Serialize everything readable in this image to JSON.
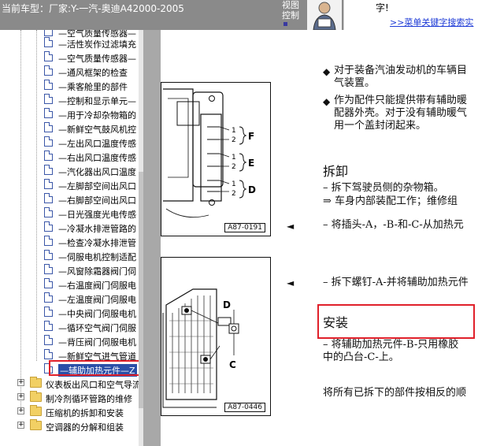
{
  "header": {
    "title": "当前车型：厂家:Y-一汽-奥迪A42000-2005",
    "view_control": [
      "视图",
      "控制"
    ],
    "ad_line1": "字!",
    "ad_link": ">>菜单关键字搜索实"
  },
  "tree": {
    "items": [
      {
        "label": "—空气质量传感器—",
        "cut": true
      },
      {
        "label": "—活性炭作过滤填充"
      },
      {
        "label": "—空气质量传感器—"
      },
      {
        "label": "—通风框架的检查"
      },
      {
        "label": "—乘客舱里的部件"
      },
      {
        "label": "—控制和显示单元—"
      },
      {
        "label": "—用于冷却杂物箱的"
      },
      {
        "label": "—新鲜空气鼓风机控"
      },
      {
        "label": "—左出风口温度传感"
      },
      {
        "label": "—右出风口温度传感"
      },
      {
        "label": "—汽化器出风口温度"
      },
      {
        "label": "—左脚部空间出风口"
      },
      {
        "label": "—右脚部空间出风口"
      },
      {
        "label": "—日光强度光电传感"
      },
      {
        "label": "—冷凝水排泄管路的"
      },
      {
        "label": "—检查冷凝水排泄管"
      },
      {
        "label": "—伺服电机控制适配"
      },
      {
        "label": "—风窗除霜器阀门伺"
      },
      {
        "label": "—右温度阀门伺服电"
      },
      {
        "label": "—左温度阀门伺服电"
      },
      {
        "label": "—中央阀门伺服电机"
      },
      {
        "label": "—循环空气阀门伺服"
      },
      {
        "label": "—背压阀门伺服电机"
      },
      {
        "label": "—新鲜空气进气管道"
      },
      {
        "label": "—辅助加热元件—Z",
        "selected": true
      }
    ],
    "folders": [
      "仪表板出风口和空气导流",
      "制冷剂循环管路的维修",
      "压缩机的拆卸和安装",
      "空调器的分解和组装"
    ]
  },
  "document": {
    "bullets": [
      "对于装备汽油发动机的车辆目",
      "气装置。",
      "作为配件只能提供带有辅助暖",
      "配器外壳。对于没有辅助暖气",
      "用一个盖封闭起来。"
    ],
    "removal_heading": "拆卸",
    "removal_steps": [
      "– 拆下驾驶员侧的杂物箱。",
      "⇒ 车身内部装配工作；维修组",
      "– 将插头-A，-B-和-C-从加热元",
      "– 拆下螺钉-A-并将辅助加热元件"
    ],
    "install_heading": "安装",
    "install_steps": [
      "– 将辅助加热元件-B-只用橡胶",
      "中的凸台-C-上。"
    ],
    "final_text": "将所有已拆下的部件按相反的顺",
    "figure1": {
      "code": "A87-0191",
      "labels": [
        "1",
        "2",
        "F",
        "1",
        "2",
        "E",
        "1",
        "2",
        "D"
      ]
    },
    "figure2": {
      "code": "A87-0446",
      "labels": [
        "D",
        "C"
      ]
    },
    "arrow": "◄"
  }
}
